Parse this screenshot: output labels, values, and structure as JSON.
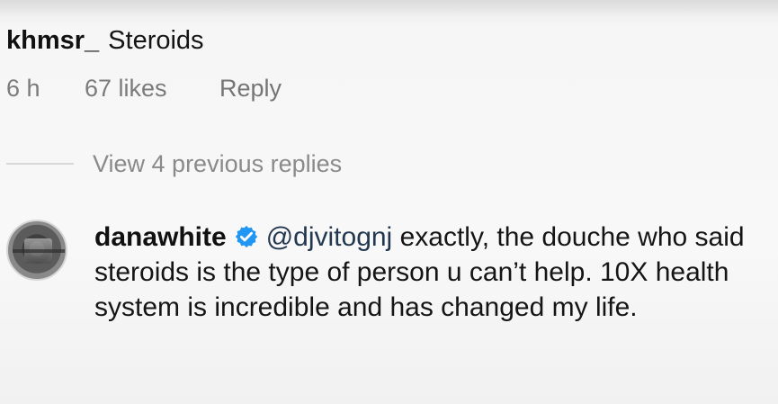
{
  "comment": {
    "username": "khmsr_",
    "text": "Steroids",
    "time": "6 h",
    "likes": "67 likes",
    "reply_label": "Reply"
  },
  "view_replies": {
    "label": "View 4 previous replies"
  },
  "reply": {
    "username": "danawhite",
    "verified_icon": "verified-badge-icon",
    "mention": "@djvitognj",
    "text": " exactly, the douche who said steroids is the type of person u can’t help. 10X health system is incredible and has changed my life."
  },
  "colors": {
    "background": "#f6f6f6",
    "meta_text": "#7b7b7b",
    "verified_blue": "#2196f3",
    "mention": "#23384f"
  }
}
